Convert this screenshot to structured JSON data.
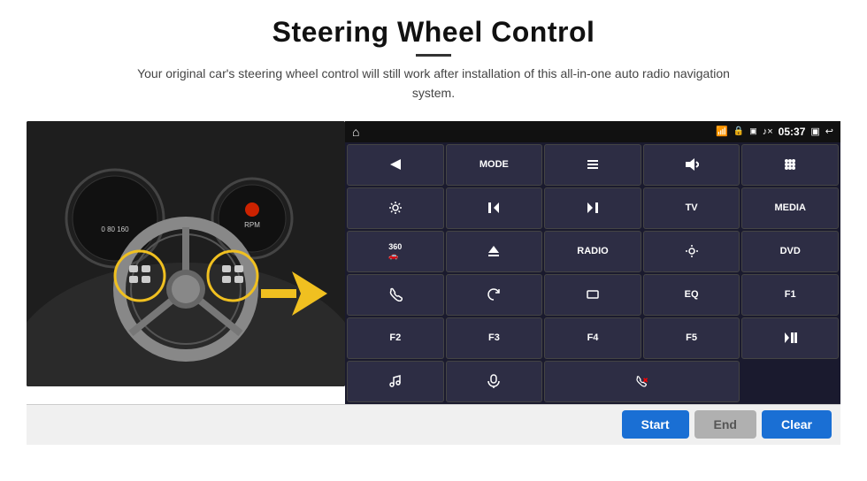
{
  "header": {
    "title": "Steering Wheel Control",
    "subtitle": "Your original car's steering wheel control will still work after installation of this all-in-one auto radio navigation system."
  },
  "status_bar": {
    "time": "05:37",
    "home_icon": "⌂",
    "wifi_icon": "wifi",
    "lock_icon": "🔒",
    "sd_icon": "SD",
    "bt_icon": "🎵",
    "back_icon": "↩"
  },
  "control_buttons": [
    {
      "id": "b1",
      "label": "",
      "icon": "send"
    },
    {
      "id": "b2",
      "label": "MODE",
      "icon": ""
    },
    {
      "id": "b3",
      "label": "",
      "icon": "menu"
    },
    {
      "id": "b4",
      "label": "",
      "icon": "mute"
    },
    {
      "id": "b5",
      "label": "",
      "icon": "dots"
    },
    {
      "id": "b6",
      "label": "",
      "icon": "settings"
    },
    {
      "id": "b7",
      "label": "",
      "icon": "prev"
    },
    {
      "id": "b8",
      "label": "",
      "icon": "next"
    },
    {
      "id": "b9",
      "label": "TV",
      "icon": ""
    },
    {
      "id": "b10",
      "label": "MEDIA",
      "icon": ""
    },
    {
      "id": "b11",
      "label": "",
      "icon": "360"
    },
    {
      "id": "b12",
      "label": "",
      "icon": "eject"
    },
    {
      "id": "b13",
      "label": "RADIO",
      "icon": ""
    },
    {
      "id": "b14",
      "label": "",
      "icon": "brightness"
    },
    {
      "id": "b15",
      "label": "DVD",
      "icon": ""
    },
    {
      "id": "b16",
      "label": "",
      "icon": "phone"
    },
    {
      "id": "b17",
      "label": "",
      "icon": "swirl"
    },
    {
      "id": "b18",
      "label": "",
      "icon": "rect"
    },
    {
      "id": "b19",
      "label": "EQ",
      "icon": ""
    },
    {
      "id": "b20",
      "label": "F1",
      "icon": ""
    },
    {
      "id": "b21",
      "label": "F2",
      "icon": ""
    },
    {
      "id": "b22",
      "label": "F3",
      "icon": ""
    },
    {
      "id": "b23",
      "label": "F4",
      "icon": ""
    },
    {
      "id": "b24",
      "label": "F5",
      "icon": ""
    },
    {
      "id": "b25",
      "label": "",
      "icon": "playpause"
    },
    {
      "id": "b26",
      "label": "",
      "icon": "music"
    },
    {
      "id": "b27",
      "label": "",
      "icon": "mic"
    },
    {
      "id": "b28",
      "label": "",
      "icon": "phone2"
    },
    {
      "id": "b29",
      "label": "",
      "icon": ""
    },
    {
      "id": "b30",
      "label": "",
      "icon": ""
    }
  ],
  "bottom_bar": {
    "start_label": "Start",
    "end_label": "End",
    "clear_label": "Clear"
  }
}
